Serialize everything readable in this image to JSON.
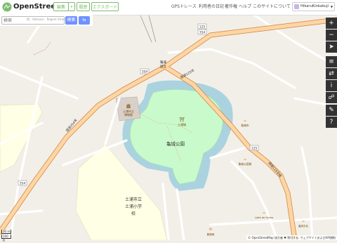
{
  "header": {
    "brand": "OpenStreetMap",
    "edit_label": "編集",
    "edit_caret": "▾",
    "history_label": "履歴",
    "export_label": "エクスポート",
    "nav": [
      "GPSトレース",
      "利用者の日記",
      "著作権",
      "ヘルプ",
      "このサイトについて"
    ],
    "user_name": "HikaruKinkakuji"
  },
  "search": {
    "placeholder": "検索",
    "hint": "例：Alkmaar、Regent Street",
    "button_label": "検索",
    "directions_label": "⇆"
  },
  "map": {
    "labels": {
      "park": "亀城公園",
      "shrine": "土浦城",
      "museum_1": "土浦市立",
      "museum_2": "博物館",
      "school_1": "土浦市立",
      "school_2": "土浦小学",
      "school_3": "校",
      "road_nw": "国道354号",
      "road_ne": "国道125号",
      "road_se": "国道125号線",
      "route_354_a": "354",
      "route_354_b": "354",
      "route_125_a": "125",
      "route_125_b": "354",
      "route_125_c": "125",
      "poi_a": "亀城市",
      "poi_b": "亀城公園前",
      "poi_c": "Latte de Senka",
      "poi_d": "亀岡文化",
      "poi_e": "郵便局",
      "misc_1": "亀城",
      "misc_2": "国立"
    }
  },
  "controls": [
    "+",
    "−",
    "➤",
    "≡",
    "⇄",
    "i",
    "☍",
    "✎",
    "?"
  ],
  "scale": {
    "top": "30 m",
    "bottom": "100 ft"
  },
  "attribution": "© OpenStreetMap 協力者 ♥ 寄付する. ウェブサイトおよびAPI規約",
  "colors": {
    "land": "#f2efe9",
    "park": "#c8facc",
    "water": "#aad3df",
    "school": "#ffffe5",
    "primary_road": "#fcd6a4",
    "primary_casing": "#d6803a",
    "brand_green": "#7ebc6f"
  }
}
